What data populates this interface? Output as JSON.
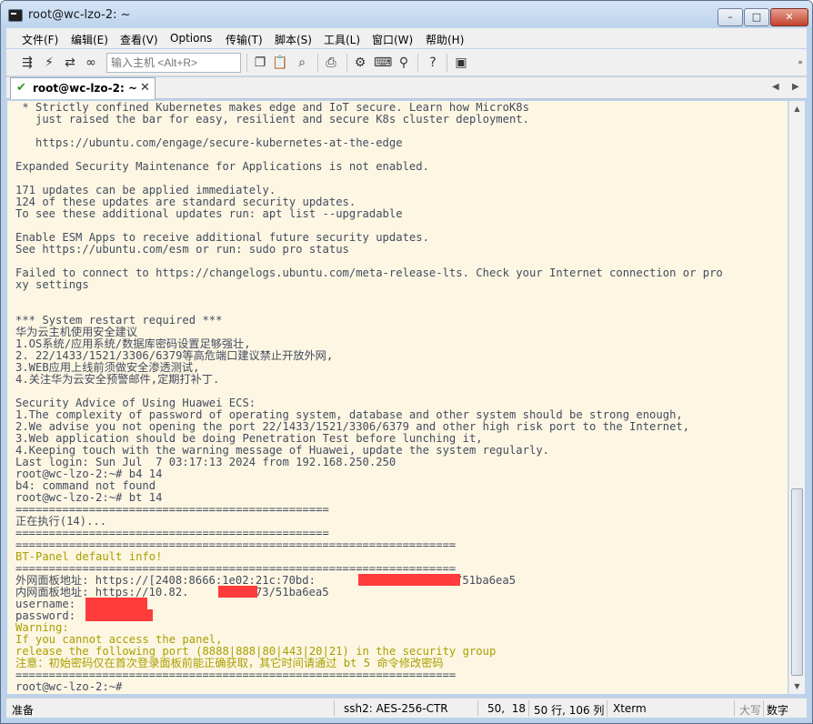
{
  "window": {
    "title": "root@wc-lzo-2: ~",
    "buttons": {
      "minimize": "–",
      "maximize": "□",
      "close": "✕"
    }
  },
  "menu": [
    "文件(F)",
    "编辑(E)",
    "查看(V)",
    "Options",
    "传输(T)",
    "脚本(S)",
    "工具(L)",
    "窗口(W)",
    "帮助(H)"
  ],
  "toolbar": {
    "host_placeholder": "输入主机 <Alt+R>",
    "icons_left": [
      "connect-icon",
      "quick-connect-icon",
      "reconnect-icon",
      "disconnect-icon"
    ],
    "icons_right": [
      "copy-icon",
      "paste-icon",
      "find-icon",
      "print-icon",
      "settings-icon",
      "keymap-icon",
      "sftp-icon",
      "help-icon",
      "screenshot-icon"
    ]
  },
  "tab": {
    "label": "root@wc-lzo-2: ~",
    "close": "✕"
  },
  "terminal": {
    "lines": [
      {
        "text": " * Strictly confined Kubernetes makes edge and IoT secure. Learn how MicroK8s",
        "color": "default"
      },
      {
        "text": "   just raised the bar for easy, resilient and secure K8s cluster deployment.",
        "color": "default"
      },
      {
        "text": "",
        "color": "default"
      },
      {
        "text": "   https://ubuntu.com/engage/secure-kubernetes-at-the-edge",
        "color": "default"
      },
      {
        "text": "",
        "color": "default"
      },
      {
        "text": "Expanded Security Maintenance for Applications is not enabled.",
        "color": "default"
      },
      {
        "text": "",
        "color": "default"
      },
      {
        "text": "171 updates can be applied immediately.",
        "color": "default"
      },
      {
        "text": "124 of these updates are standard security updates.",
        "color": "default"
      },
      {
        "text": "To see these additional updates run: apt list --upgradable",
        "color": "default"
      },
      {
        "text": "",
        "color": "default"
      },
      {
        "text": "Enable ESM Apps to receive additional future security updates.",
        "color": "default"
      },
      {
        "text": "See https://ubuntu.com/esm or run: sudo pro status",
        "color": "default"
      },
      {
        "text": "",
        "color": "default"
      },
      {
        "text": "Failed to connect to https://changelogs.ubuntu.com/meta-release-lts. Check your Internet connection or pro",
        "color": "default"
      },
      {
        "text": "xy settings",
        "color": "default"
      },
      {
        "text": "",
        "color": "default"
      },
      {
        "text": "",
        "color": "default"
      },
      {
        "text": "*** System restart required ***",
        "color": "default"
      },
      {
        "text": "华为云主机使用安全建议",
        "color": "default"
      },
      {
        "text": "1.OS系统/应用系统/数据库密码设置足够强壮,",
        "color": "default"
      },
      {
        "text": "2. 22/1433/1521/3306/6379等高危端口建议禁止开放外网,",
        "color": "default"
      },
      {
        "text": "3.WEB应用上线前须做安全渗透测试,",
        "color": "default"
      },
      {
        "text": "4.关注华为云安全预警邮件,定期打补丁.",
        "color": "default"
      },
      {
        "text": "",
        "color": "default"
      },
      {
        "text": "Security Advice of Using Huawei ECS:",
        "color": "default"
      },
      {
        "text": "1.The complexity of password of operating system, database and other system should be strong enough,",
        "color": "default"
      },
      {
        "text": "2.We advise you not opening the port 22/1433/1521/3306/6379 and other high risk port to the Internet,",
        "color": "default"
      },
      {
        "text": "3.Web application should be doing Penetration Test before lunching it,",
        "color": "default"
      },
      {
        "text": "4.Keeping touch with the warning message of Huawei, update the system regularly.",
        "color": "default"
      },
      {
        "text": "Last login: Sun Jul  7 03:17:13 2024 from 192.168.250.250",
        "color": "default"
      },
      {
        "text": "root@wc-lzo-2:~# b4 14",
        "color": "default"
      },
      {
        "text": "b4: command not found",
        "color": "default"
      },
      {
        "text": "root@wc-lzo-2:~# bt 14",
        "color": "default"
      },
      {
        "text": "===============================================",
        "color": "default"
      },
      {
        "text": "正在执行(14)...",
        "color": "default"
      },
      {
        "text": "===============================================",
        "color": "default"
      },
      {
        "text": "==================================================================",
        "color": "default"
      },
      {
        "text": "BT-Panel default info!",
        "color": "yellow"
      },
      {
        "text": "==================================================================",
        "color": "default"
      },
      {
        "text": "外网面板地址: https://[2408:8666:1e02:21c:70bd:              ]:32573/51ba6ea5",
        "color": "default"
      },
      {
        "text": "内网面板地址: https://10.82.      :32573/51ba6ea5",
        "color": "default"
      },
      {
        "text": "username: ",
        "color": "default"
      },
      {
        "text": "password: ",
        "color": "default"
      },
      {
        "text": "Warning:",
        "color": "yellow"
      },
      {
        "text": "If you cannot access the panel,",
        "color": "yellow"
      },
      {
        "text": "release the following port (8888|888|80|443|20|21) in the security group",
        "color": "yellow"
      },
      {
        "text": "注意：初始密码仅在首次登录面板前能正确获取，其它时间请通过 bt 5 命令修改密码",
        "color": "yellow"
      },
      {
        "text": "==================================================================",
        "color": "default"
      },
      {
        "text": "root@wc-lzo-2:~# ",
        "color": "default"
      }
    ]
  },
  "status": {
    "ready": "准备",
    "protocol": "ssh2: AES-256-CTR",
    "cursor": "50,  18",
    "size": "50 行, 106 列",
    "term": "Xterm",
    "caps": "大写",
    "num": "数字"
  }
}
